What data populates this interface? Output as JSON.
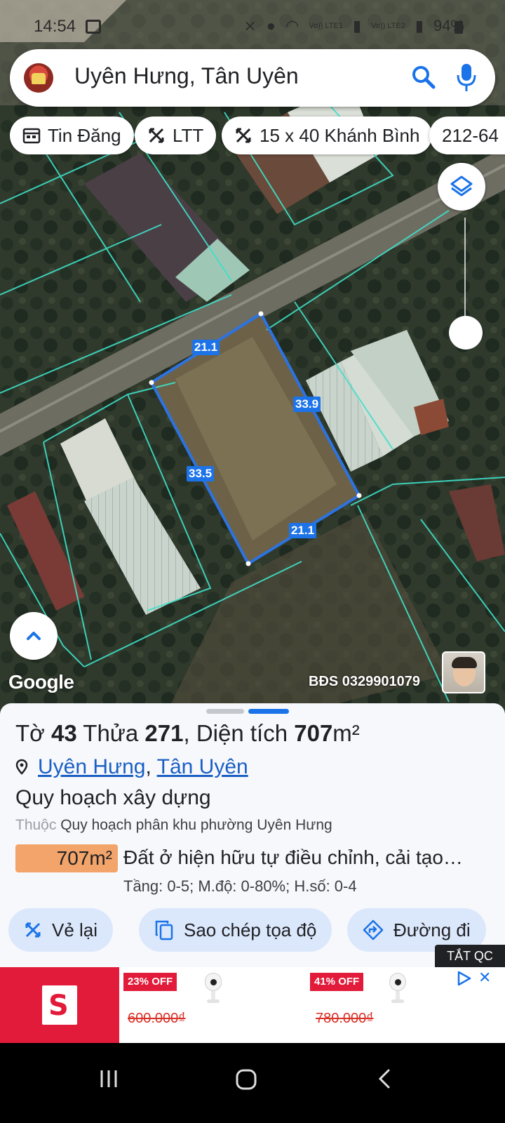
{
  "status_bar": {
    "time": "14:54",
    "network_1": "Vo)) LTE1",
    "network_2": "Vo)) LTE2",
    "battery": "94%"
  },
  "search": {
    "place": "Uyên Hưng, Tân Uyên",
    "icons": [
      "avatar",
      "search-icon",
      "mic-icon"
    ]
  },
  "chips": [
    {
      "label": "Tin Đăng",
      "icon": "calendar-icon"
    },
    {
      "label": "LTT",
      "icon": "measure-icon"
    },
    {
      "label": "15 x 40 Khánh Bình",
      "icon": "measure-icon"
    },
    {
      "label": "212-64",
      "icon": ""
    }
  ],
  "map": {
    "attribution": "Google",
    "agent_label": "BĐS 0329901079",
    "dimensions": {
      "top": "21.1",
      "right": "33.9",
      "left": "33.5",
      "bottom": "21.1"
    }
  },
  "parcel": {
    "sheet_label": "Tờ",
    "sheet_no": "43",
    "plot_label": "Thửa",
    "plot_no": "271",
    "area_label": "Diện tích",
    "area_value": "707",
    "area_unit": "m²",
    "ward": "Uyên Hưng",
    "district": "Tân Uyên",
    "plan_type": "Quy hoạch xây dựng",
    "belongs_label": "Thuộc",
    "plan_name": "Quy hoạch phân khu phường Uyên Hưng",
    "zone_area": "707m²",
    "zone_name": "Đất ở hiện hữu tự điều chỉnh, cải tạo…",
    "zone_params": "Tầng: 0-5; M.độ: 0-80%; H.số: 0-4"
  },
  "actions": {
    "redraw": "Vẻ lại",
    "copy_coords": "Sao chép tọa độ",
    "directions": "Đường đi"
  },
  "close_ads": "TẮT QC",
  "ad": {
    "logo_letter": "S",
    "items": [
      {
        "discount": "23% OFF",
        "price": "600.000₫"
      },
      {
        "discount": "41% OFF",
        "price": "780.000₫"
      }
    ]
  },
  "colors": {
    "accent": "#1a73e8",
    "parcel_outline": "#2d73e0",
    "cadastral_lines": "#3fe0c8",
    "area_badge": "#f2a46a",
    "ad_brand": "#e21b3a"
  }
}
